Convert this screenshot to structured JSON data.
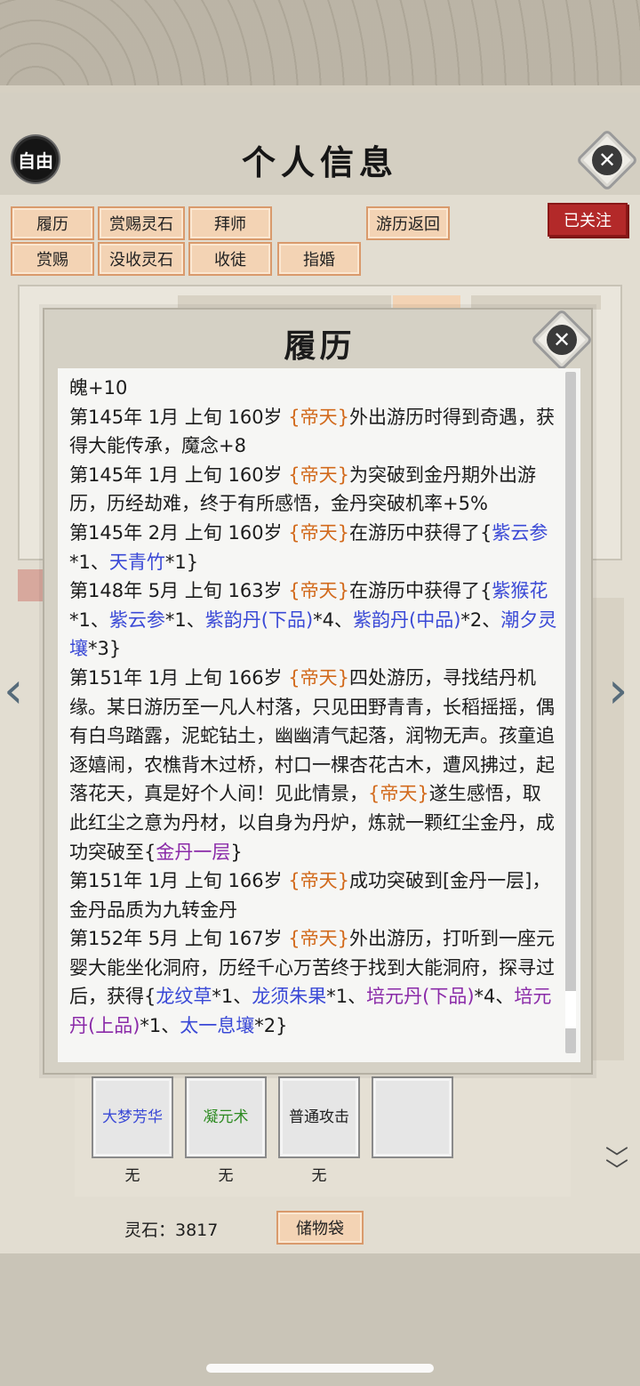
{
  "header": {
    "badge": "自由",
    "title": "个人信息"
  },
  "actions": {
    "row1": [
      "履历",
      "赏赐灵石",
      "拜师"
    ],
    "row2": [
      "赏赐",
      "没收灵石",
      "收徒",
      "指婚"
    ],
    "return_label": "游历返回",
    "follow_label": "已关注"
  },
  "modal": {
    "title": "履历",
    "entries": [
      {
        "segments": [
          {
            "t": "魄+10",
            "c": ""
          }
        ]
      },
      {
        "segments": [
          {
            "t": "第145年 1月 上旬 160岁 ",
            "c": ""
          },
          {
            "t": "{帝天}",
            "c": "n"
          },
          {
            "t": "外出游历时得到奇遇，获得大能传承，魔念+8",
            "c": ""
          }
        ]
      },
      {
        "segments": [
          {
            "t": "第145年 1月 上旬 160岁 ",
            "c": ""
          },
          {
            "t": "{帝天}",
            "c": "n"
          },
          {
            "t": "为突破到金丹期外出游历，历经劫难，终于有所感悟，金丹突破机率+5%",
            "c": ""
          }
        ]
      },
      {
        "segments": [
          {
            "t": "第145年 2月 上旬  160岁  ",
            "c": ""
          },
          {
            "t": "{帝天}",
            "c": "n"
          },
          {
            "t": "在游历中获得了{",
            "c": ""
          },
          {
            "t": "紫云参",
            "c": "b"
          },
          {
            "t": "*1、",
            "c": ""
          },
          {
            "t": "天青竹",
            "c": "b"
          },
          {
            "t": "*1}",
            "c": ""
          }
        ]
      },
      {
        "segments": [
          {
            "t": "第148年 5月 上旬  163岁  ",
            "c": ""
          },
          {
            "t": "{帝天}",
            "c": "n"
          },
          {
            "t": "在游历中获得了{",
            "c": ""
          },
          {
            "t": "紫猴花",
            "c": "b"
          },
          {
            "t": "*1、",
            "c": ""
          },
          {
            "t": "紫云参",
            "c": "b"
          },
          {
            "t": "*1、",
            "c": ""
          },
          {
            "t": "紫韵丹(下品)",
            "c": "b"
          },
          {
            "t": "*4、",
            "c": ""
          },
          {
            "t": "紫韵丹(中品)",
            "c": "b"
          },
          {
            "t": "*2、",
            "c": ""
          },
          {
            "t": "潮夕灵壤",
            "c": "b"
          },
          {
            "t": "*3}",
            "c": ""
          }
        ]
      },
      {
        "segments": [
          {
            "t": "第151年 1月 上旬 166岁 ",
            "c": ""
          },
          {
            "t": "{帝天}",
            "c": "n"
          },
          {
            "t": "四处游历，寻找结丹机缘。某日游历至一凡人村落，只见田野青青，长稻摇摇，偶有白鸟踏露，泥蛇钻土，幽幽清气起落，润物无声。孩童追逐嬉闹，农樵背木过桥，村口一棵杏花古木，遭风拂过，起落花天，真是好个人间！见此情景，",
            "c": ""
          },
          {
            "t": "{帝天}",
            "c": "n"
          },
          {
            "t": "遂生感悟，取此红尘之意为丹材，以自身为丹炉，炼就一颗红尘金丹，成功突破至{",
            "c": ""
          },
          {
            "t": "金丹一层",
            "c": "p"
          },
          {
            "t": "}",
            "c": ""
          }
        ]
      },
      {
        "segments": [
          {
            "t": "第151年  1月  上旬    166岁   ",
            "c": ""
          },
          {
            "t": "{帝天}",
            "c": "n"
          },
          {
            "t": "成功突破到[金丹一层]，金丹品质为九转金丹",
            "c": ""
          }
        ]
      },
      {
        "segments": [
          {
            "t": "第152年 5月 上旬 167岁 ",
            "c": ""
          },
          {
            "t": "{帝天}",
            "c": "n"
          },
          {
            "t": "外出游历，打听到一座元婴大能坐化洞府，历经千心万苦终于找到大能洞府，探寻过后，获得{",
            "c": ""
          },
          {
            "t": "龙纹草",
            "c": "b"
          },
          {
            "t": "*1、",
            "c": ""
          },
          {
            "t": "龙须朱果",
            "c": "b"
          },
          {
            "t": "*1、",
            "c": ""
          },
          {
            "t": "培元丹(下品)",
            "c": "p"
          },
          {
            "t": "*4、",
            "c": ""
          },
          {
            "t": "培元丹(上品)",
            "c": "p"
          },
          {
            "t": "*1、",
            "c": ""
          },
          {
            "t": "太一息壤",
            "c": "b"
          },
          {
            "t": "*2}",
            "c": ""
          }
        ]
      }
    ]
  },
  "skills": [
    {
      "name": "大梦芳华",
      "color": "#3a49d6",
      "sub": "无"
    },
    {
      "name": "凝元术",
      "color": "#2e8b22",
      "sub": "无"
    },
    {
      "name": "普通攻击",
      "color": "#1e1e1e",
      "sub": "无"
    },
    {
      "name": "",
      "color": "#1e1e1e",
      "sub": ""
    }
  ],
  "footer": {
    "spirit_stone": "灵石：3817",
    "storage_label": "储物袋"
  },
  "colors": {
    "name": "#d26a1c",
    "item_blue": "#3a49d6",
    "item_purple": "#8a2aa8",
    "follow_red": "#b32929"
  }
}
